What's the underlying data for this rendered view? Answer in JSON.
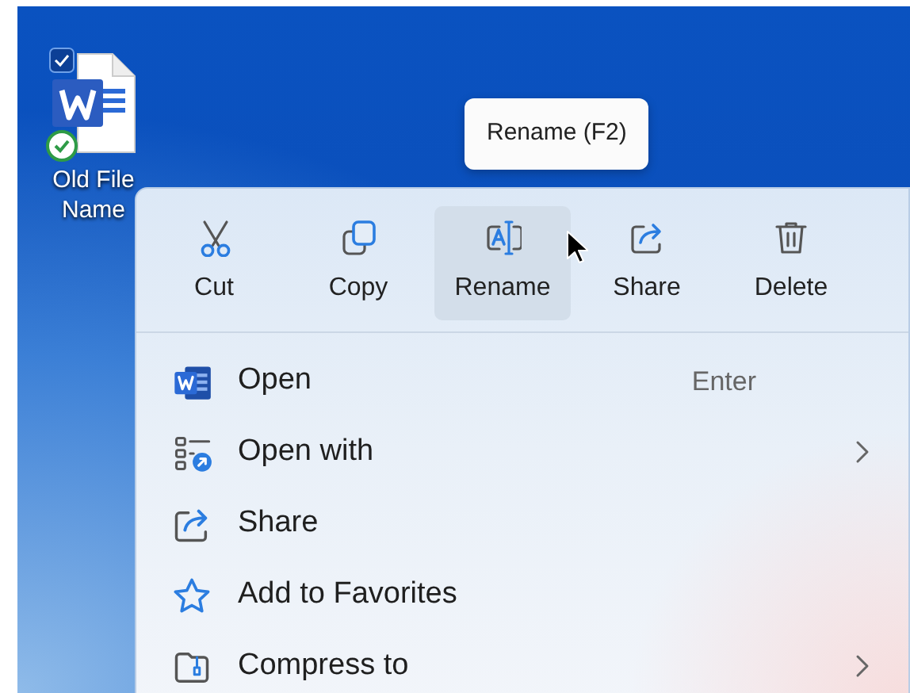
{
  "desktop_icon": {
    "label": "Old File Name",
    "selected": true,
    "synced": true
  },
  "tooltip": {
    "text": "Rename (F2)"
  },
  "toolbar": [
    {
      "kind": "cut",
      "label": "Cut",
      "hovered": false
    },
    {
      "kind": "copy",
      "label": "Copy",
      "hovered": false
    },
    {
      "kind": "rename",
      "label": "Rename",
      "hovered": true
    },
    {
      "kind": "share",
      "label": "Share",
      "hovered": false
    },
    {
      "kind": "delete",
      "label": "Delete",
      "hovered": false
    }
  ],
  "menu_items": [
    {
      "kind": "document",
      "label": "Open",
      "shortcut": "Enter",
      "submenu": false
    },
    {
      "kind": "open-with",
      "label": "Open with",
      "submenu": true
    },
    {
      "kind": "share",
      "label": "Share",
      "submenu": false
    },
    {
      "kind": "star",
      "label": "Add to Favorites",
      "submenu": false
    },
    {
      "kind": "compress",
      "label": "Compress to",
      "submenu": true
    }
  ]
}
